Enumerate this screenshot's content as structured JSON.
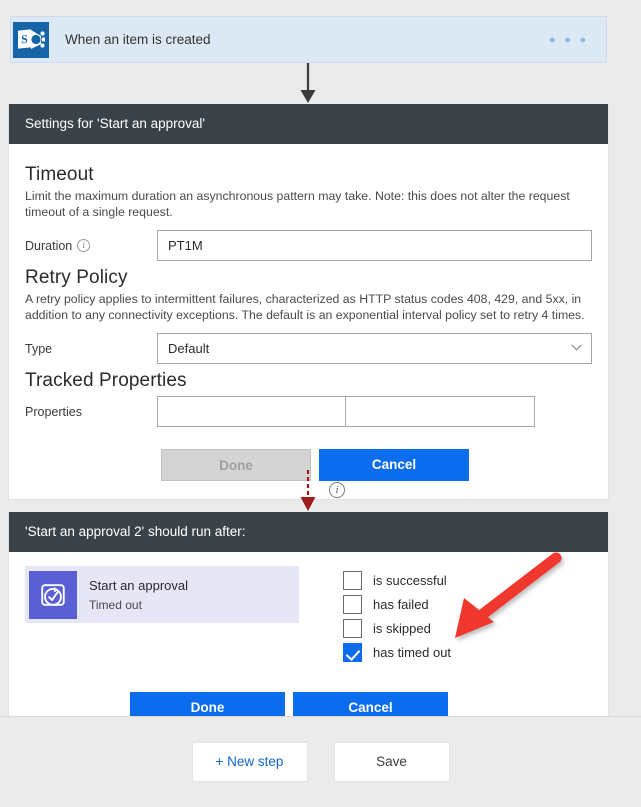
{
  "trigger": {
    "icon": "sharepoint-icon",
    "icon_letter": "S",
    "title": "When an item is created",
    "menu": "• • •"
  },
  "settings_panel": {
    "header": "Settings for 'Start an approval'",
    "timeout": {
      "title": "Timeout",
      "description": "Limit the maximum duration an asynchronous pattern may take. Note: this does not alter the request timeout of a single request.",
      "duration_label": "Duration",
      "duration_info": "i",
      "duration_value": "PT1M"
    },
    "retry_policy": {
      "title": "Retry Policy",
      "description": "A retry policy applies to intermittent failures, characterized as HTTP status codes 408, 429, and 5xx, in addition to any connectivity exceptions. The default is an exponential interval policy set to retry 4 times.",
      "type_label": "Type",
      "type_value": "Default"
    },
    "tracked_properties": {
      "title": "Tracked Properties",
      "properties_label": "Properties",
      "key_value": "",
      "value_value": ""
    },
    "buttons": {
      "done": "Done",
      "done_disabled": true,
      "cancel": "Cancel"
    }
  },
  "connector": {
    "info_badge": "i"
  },
  "run_after_panel": {
    "header": "'Start an approval 2' should run after:",
    "action_card": {
      "icon": "approval-icon",
      "title": "Start an approval",
      "status": "Timed out"
    },
    "conditions": [
      {
        "label": "is successful",
        "checked": false
      },
      {
        "label": "has failed",
        "checked": false
      },
      {
        "label": "is skipped",
        "checked": false
      },
      {
        "label": "has timed out",
        "checked": true
      }
    ],
    "buttons": {
      "done": "Done",
      "cancel": "Cancel"
    }
  },
  "bottom_bar": {
    "new_step": "+ New step",
    "save": "Save"
  },
  "colors": {
    "accent_blue": "#0b6ced",
    "panel_header": "#3b4348",
    "trigger_bg": "#dce9f5",
    "sharepoint_blue": "#1565a8",
    "approval_purple": "#5b5fd4",
    "annotation_red": "#f0382d",
    "dashed_arrow": "#9e1b1b"
  }
}
